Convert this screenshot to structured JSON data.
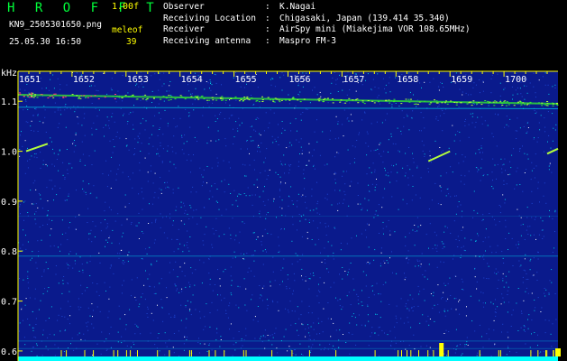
{
  "header": {
    "app_name": "H R O F F T",
    "version": "1.00f",
    "filename": "KN9_2505301650.png",
    "software": "meleof",
    "datetime": "25.05.30 16:50",
    "count": "39",
    "meta": [
      {
        "key": "Observer",
        "value": "K.Nagai"
      },
      {
        "key": "Receiving Location",
        "value": "Chigasaki, Japan (139.414 35.340)"
      },
      {
        "key": "Receiver",
        "value": "AirSpy mini (Miakejima VOR 108.65MHz)"
      },
      {
        "key": "Receiving antenna",
        "value": "Maspro FM-3"
      }
    ]
  },
  "chart_data": {
    "type": "heatmap",
    "ylabel": "kHz",
    "x_ticks": [
      "1651",
      "1652",
      "1653",
      "1654",
      "1655",
      "1656",
      "1657",
      "1658",
      "1659",
      "1700"
    ],
    "y_ticks": [
      "1.1",
      "1.0",
      "0.9",
      "0.8",
      "0.7",
      "0.6"
    ],
    "y_tick_values": [
      1.1,
      1.0,
      0.9,
      0.8,
      0.7,
      0.6
    ],
    "x_range_minutes": [
      0,
      10
    ],
    "y_range_khz": [
      0.58,
      1.16
    ],
    "colors": {
      "background": "#0a1a8c",
      "noise_low": "#1e46d2",
      "noise_mid": "#00c8e6",
      "noise_high": "#ffffff",
      "carrier": "#32e632",
      "echo": "#b4ff3c",
      "peak": "#ff3c78",
      "axis": "#ffff00",
      "baseline": "#00ffff"
    }
  }
}
